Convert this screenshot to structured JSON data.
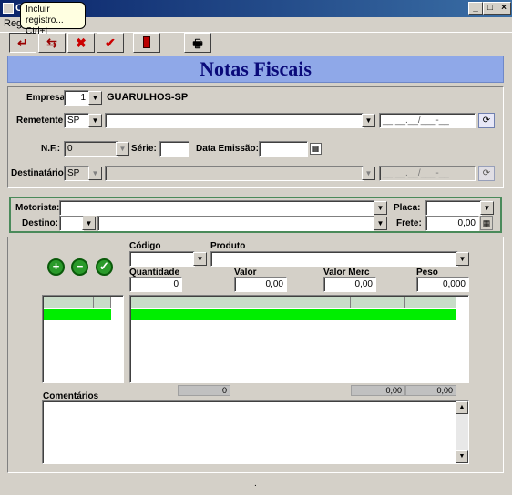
{
  "window": {
    "title": "C",
    "controls": [
      "_",
      "□",
      "×"
    ]
  },
  "menu": {
    "item": "Regis"
  },
  "tooltip": {
    "line1": "Incluir registro...",
    "line2": "Ctrl+I"
  },
  "header": {
    "title": "Notas Fiscais"
  },
  "empresa": {
    "label": "Empresa",
    "value": "1",
    "name": "GUARULHOS-SP"
  },
  "remetente": {
    "label": "Remetente",
    "uf": "SP",
    "value": "",
    "date": "__.__.__/___-__"
  },
  "nf": {
    "label": "N.F.:",
    "value": "0",
    "serie_label": "Série:",
    "serie": "",
    "data_label": "Data Emissão:",
    "data": ""
  },
  "destinatario": {
    "label": "Destinatário",
    "uf": "SP",
    "value": "",
    "date": "__.__.__/___-__"
  },
  "motorista": {
    "label": "Motorista:",
    "value": "",
    "placa_label": "Placa:",
    "placa": ""
  },
  "destino": {
    "label": "Destino:",
    "uf": "",
    "value": "",
    "frete_label": "Frete:",
    "frete": "0,00"
  },
  "item": {
    "codigo_label": "Código",
    "produto_label": "Produto",
    "quantidade_label": "Quantidade",
    "quantidade": "0",
    "valor_label": "Valor",
    "valor": "0,00",
    "valor_merc_label": "Valor Merc",
    "valor_merc": "0,00",
    "peso_label": "Peso",
    "peso": "0,000"
  },
  "totals": {
    "qty": "0",
    "valor_merc": "0,00",
    "peso": "0,00"
  },
  "comentarios": {
    "label": "Comentários",
    "value": ""
  },
  "status": {
    "text": "."
  }
}
